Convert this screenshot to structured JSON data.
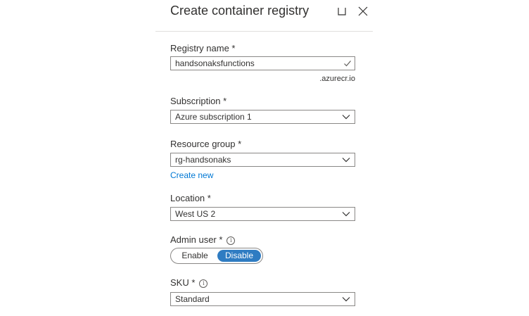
{
  "blade": {
    "title": "Create container registry",
    "maximize_icon": "maximize-icon",
    "close_icon": "close-icon"
  },
  "fields": {
    "registry_name": {
      "label": "Registry name *",
      "value": "handsonaksfunctions",
      "suffix": ".azurecr.io",
      "validated": true
    },
    "subscription": {
      "label": "Subscription *",
      "value": "Azure subscription 1"
    },
    "resource_group": {
      "label": "Resource group *",
      "value": "rg-handsonaks",
      "create_new_link": "Create new"
    },
    "location": {
      "label": "Location *",
      "value": "West US 2"
    },
    "admin_user": {
      "label": "Admin user *",
      "info_icon": "info-icon",
      "options": [
        "Enable",
        "Disable"
      ],
      "selected": "Disable"
    },
    "sku": {
      "label": "SKU *",
      "info_icon": "info-icon",
      "value": "Standard"
    }
  },
  "colors": {
    "accent": "#2f7cc2",
    "link": "#0078d4",
    "border": "#8a8886",
    "text": "#323130"
  }
}
